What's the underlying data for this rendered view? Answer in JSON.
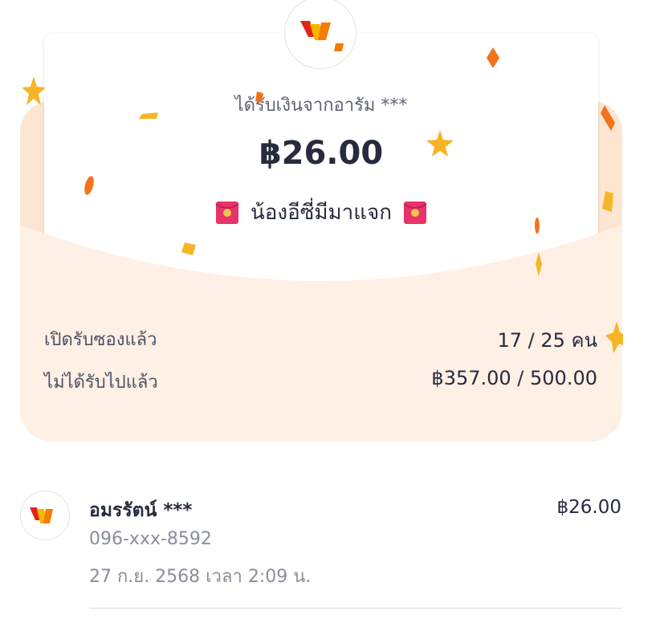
{
  "header": {
    "sender_line": "ได้รับเงินจากอารัม ***",
    "amount": "฿26.00",
    "message": "น้องอีซี่มีมาแจก"
  },
  "stats": {
    "opened_label": "เปิดรับซองแล้ว",
    "opened_value": "17 / 25 คน",
    "remaining_label": "ไม่ได้รับไปแล้ว",
    "remaining_value": "฿357.00 / 500.00"
  },
  "recipients": [
    {
      "name": "อมรรัตน์ ***",
      "phone": "096-xxx-8592",
      "time": "27 ก.ย. 2568 เวลา 2:09 น.",
      "amount": "฿26.00"
    }
  ],
  "colors": {
    "envelope": "#fde6d1",
    "envelope_front": "#fff0e6",
    "confetti_orange": "#f2731c",
    "confetti_gold": "#f6b526"
  },
  "icons": {
    "brand": "wallet-logo-icon",
    "envelope": "red-envelope-icon"
  }
}
